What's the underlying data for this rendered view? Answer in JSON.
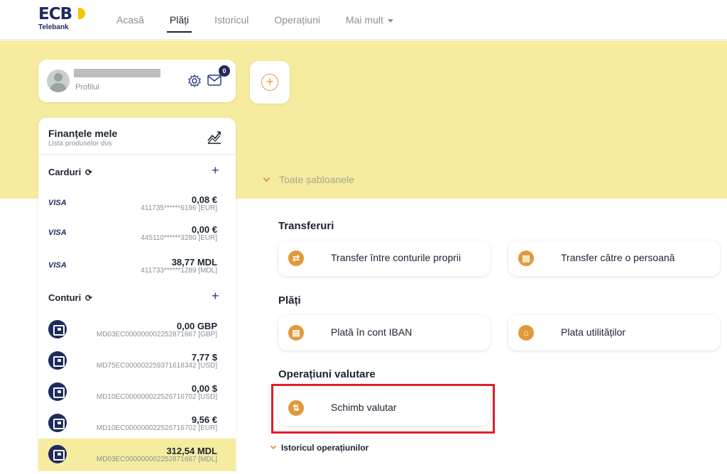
{
  "logo": {
    "main": "ECB",
    "sub": "Telebank"
  },
  "nav": {
    "items": [
      {
        "label": "Acasă",
        "active": false
      },
      {
        "label": "Plăți",
        "active": true
      },
      {
        "label": "Istoricul",
        "active": false
      },
      {
        "label": "Operațiuni",
        "active": false
      },
      {
        "label": "Mai mult",
        "active": false,
        "dropdown": true
      }
    ]
  },
  "profile": {
    "link": "Profilul",
    "notifications": "0"
  },
  "templates": {
    "label": "Toate șabloanele"
  },
  "finances": {
    "title": "Finanțele mele",
    "subtitle": "Lista produselor dvs",
    "cards_title": "Carduri",
    "cards": [
      {
        "brand": "VISA",
        "amount": "0,08 €",
        "number": "411735******6196 [EUR]"
      },
      {
        "brand": "VISA",
        "amount": "0,00 €",
        "number": "445110******3280 [EUR]"
      },
      {
        "brand": "VISA",
        "amount": "38,77 MDL",
        "number": "411733******1289 [MDL]"
      }
    ],
    "accounts_title": "Conturi",
    "accounts": [
      {
        "amount": "0,00 GBP",
        "iban": "MD03EC000000002252871667 [GBP]"
      },
      {
        "amount": "7,77 $",
        "iban": "MD75EC000002259371618342 [USD]"
      },
      {
        "amount": "0,00 $",
        "iban": "MD10EC000000022526716702 [USD]"
      },
      {
        "amount": "9,56 €",
        "iban": "MD10EC000000022526716702 [EUR]"
      },
      {
        "amount": "312,54 MDL",
        "iban": "MD03EC000000002252871667 [MDL]",
        "selected": true
      }
    ]
  },
  "sections": {
    "transfers": {
      "title": "Transferuri",
      "items": [
        {
          "label": "Transfer între conturile proprii",
          "icon": "swap-icon"
        },
        {
          "label": "Transfer către o persoană",
          "icon": "bank-icon"
        }
      ]
    },
    "payments": {
      "title": "Plăți",
      "items": [
        {
          "label": "Plată în cont IBAN",
          "icon": "bank-icon"
        },
        {
          "label": "Plata utilităților",
          "icon": "home-icon"
        }
      ]
    },
    "fx": {
      "title": "Operațiuni valutare",
      "items": [
        {
          "label": "Schimb valutar",
          "icon": "exchange-icon"
        }
      ]
    },
    "history": {
      "label": "Istoricul operațiunilor"
    }
  },
  "colors": {
    "band": "#f5eca0",
    "accent": "#e0993b",
    "brand": "#1f2a5e",
    "highlight": "#e0202a"
  }
}
